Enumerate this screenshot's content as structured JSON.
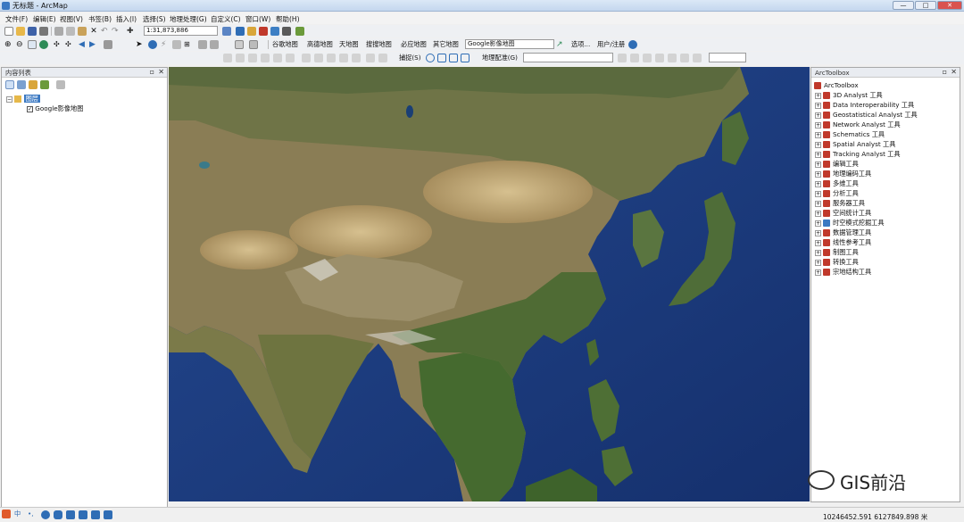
{
  "window": {
    "title": "无标题 - ArcMap",
    "min": "—",
    "max": "□",
    "close": "✕"
  },
  "menu": [
    "文件(F)",
    "编辑(E)",
    "视图(V)",
    "书签(B)",
    "插入(I)",
    "选择(S)",
    "地理处理(G)",
    "自定义(C)",
    "窗口(W)",
    "帮助(H)"
  ],
  "toolbar1": {
    "scale": "1:31,873,886"
  },
  "toolbar2": {
    "basemaps": [
      "谷歌地图",
      "高德地图",
      "天地图",
      "搜搜地图",
      "必应地图",
      "其它地图"
    ],
    "current_map": "Google影像地图",
    "options": "选项...",
    "register": "用户/注册"
  },
  "toolbar3": {
    "capture": "捕捉(S)",
    "georef": "地理配准(G)",
    "georef_layer": ""
  },
  "toc": {
    "title": "内容列表",
    "layers_group": "图层",
    "layer": "Google影像地图",
    "layer_checked": true
  },
  "arctoolbox": {
    "title": "ArcToolbox",
    "root": "ArcToolbox",
    "items": [
      "3D Analyst 工具",
      "Data Interoperability 工具",
      "Geostatistical Analyst 工具",
      "Network Analyst 工具",
      "Schematics 工具",
      "Spatial Analyst 工具",
      "Tracking Analyst 工具",
      "编辑工具",
      "地理编码工具",
      "多维工具",
      "分析工具",
      "服务器工具",
      "空间统计工具",
      "时空模式挖掘工具",
      "数据管理工具",
      "线性参考工具",
      "制图工具",
      "转换工具",
      "宗地结构工具"
    ]
  },
  "status": {
    "coords": "10246452.591  6127849.898 米"
  },
  "watermark": "GIS前沿",
  "colors": {
    "ocean": "#1d3f86",
    "accent": "#3a78c2",
    "tool_icon": "#c0392b"
  }
}
